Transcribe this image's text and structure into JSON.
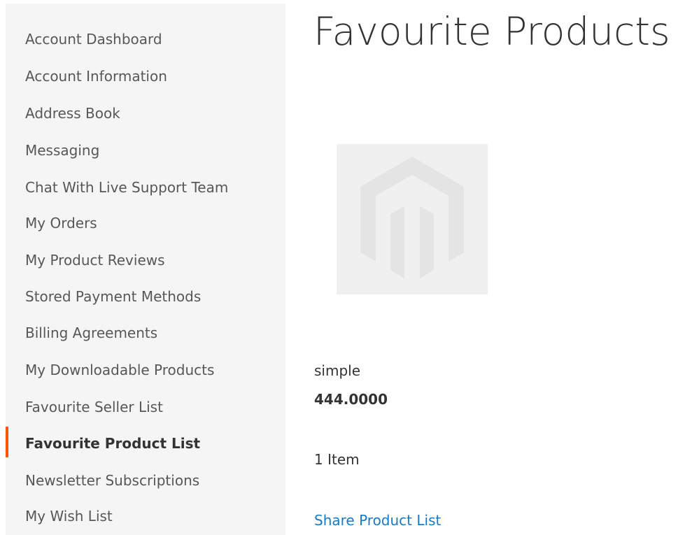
{
  "sidebar": {
    "items": [
      {
        "label": "Account Dashboard"
      },
      {
        "label": "Account Information"
      },
      {
        "label": "Address Book"
      },
      {
        "label": "Messaging"
      },
      {
        "label": "Chat With Live Support Team"
      },
      {
        "label": "My Orders"
      },
      {
        "label": "My Product Reviews"
      },
      {
        "label": "Stored Payment Methods"
      },
      {
        "label": "Billing Agreements"
      },
      {
        "label": "My Downloadable Products"
      },
      {
        "label": "Favourite Seller List"
      },
      {
        "label": "Favourite Product List",
        "current": true
      },
      {
        "label": "Newsletter Subscriptions"
      },
      {
        "label": "My Wish List"
      }
    ]
  },
  "main": {
    "title": "Favourite Products",
    "product": {
      "image_icon": "magento-placeholder-icon",
      "name": "simple",
      "price": "444.0000"
    },
    "item_count": "1 Item",
    "share_link": "Share Product List"
  },
  "colors": {
    "sidebar_bg": "#f5f5f5",
    "active_marker": "#ff5501",
    "link": "#1979c3",
    "text": "#333333",
    "nav_text": "#575757",
    "image_placeholder_bg": "#f0f0f0"
  }
}
